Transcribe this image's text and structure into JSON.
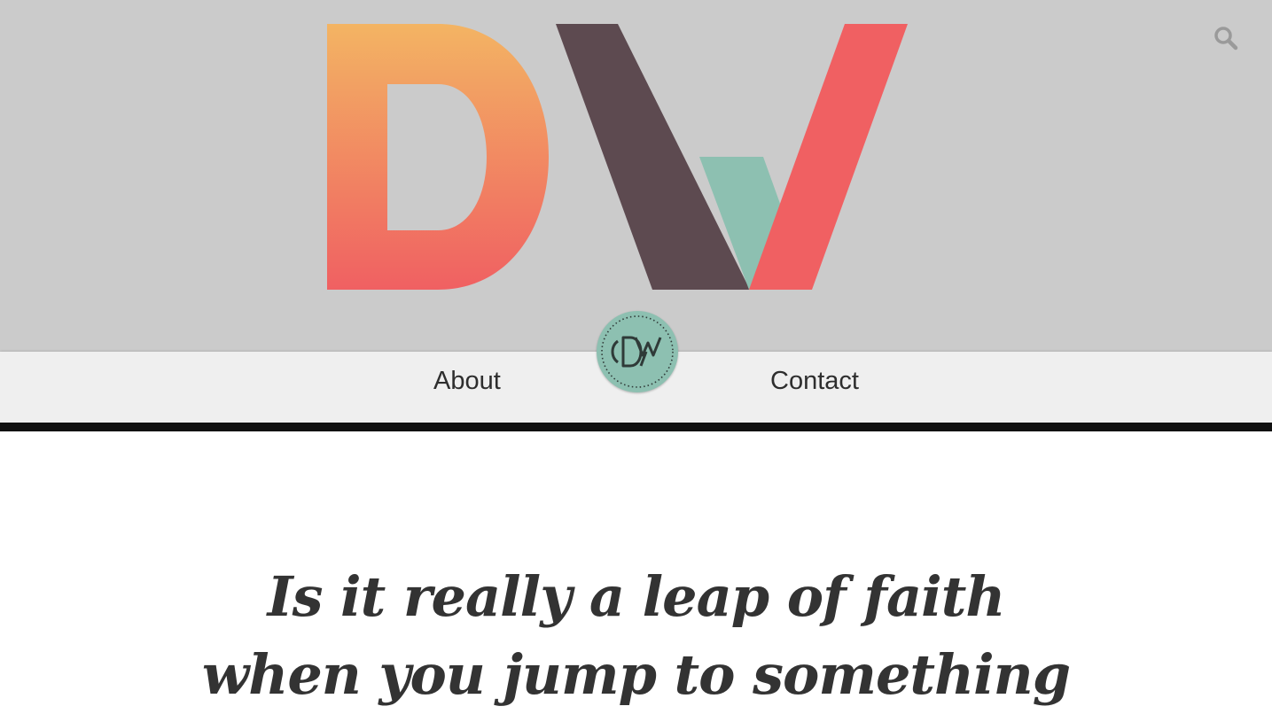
{
  "brand": {
    "logo_letters": "DW",
    "badge_monogram": "DW",
    "colors": {
      "header_bg": "#cbcbcb",
      "d_gradient_top": "#f3b463",
      "d_gradient_bottom": "#f06062",
      "w_dark": "#5d4a50",
      "w_teal": "#8dc0b1",
      "w_coral": "#f06062",
      "nav_bg": "#efefef",
      "divider": "#111111"
    }
  },
  "header": {
    "search_icon": "search-icon"
  },
  "nav": {
    "items": [
      {
        "label": "About"
      },
      {
        "label": "Contact"
      }
    ]
  },
  "post": {
    "title_line1": "Is it really a leap of faith",
    "title_line2": "when you jump to something"
  }
}
